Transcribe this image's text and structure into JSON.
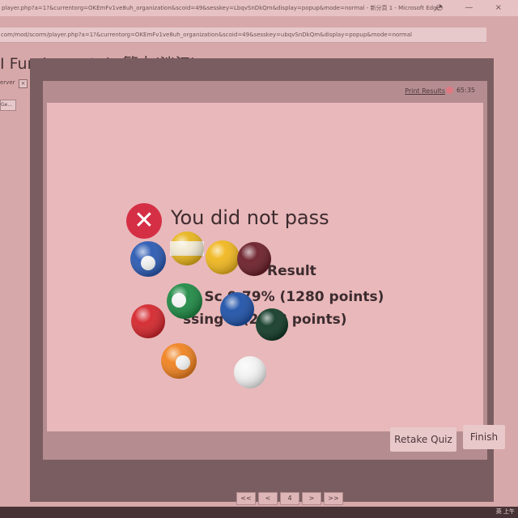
{
  "browser": {
    "window_title": "player.php?a=1?&currentorg=OKEmFv1ve8uh_organization&scoid=49&sesskey=LbqvSnDkQm&display=popup&mode=normal - 新分頁 1 - Microsoft Edge",
    "address": "com/mod/scorm/player.php?a=1?&currentorg=OKEmFv1ve8uh_organization&scoid=49&sesskey=ubqvSnDkQm&display=popup&mode=normal",
    "controls": "◔  —  ×"
  },
  "page": {
    "title": "I Fundamentals 繁中(淡江)",
    "side_text": "erver",
    "side_mini": "×",
    "side_go": "Ge..."
  },
  "quiz": {
    "print_results": "Print Results",
    "timer": "65:35",
    "fail_icon": "✕",
    "fail_heading": "You did not pass",
    "result_label": "Result",
    "score_line": "ur Sc   0.79% (1280 points)",
    "passing_line": "ssing        e   (2268 points)",
    "retake_button": "Retake Quiz",
    "finish_button": "Finish"
  },
  "pager": [
    "<<",
    "<",
    "4",
    ">",
    ">>"
  ],
  "taskbar": {
    "tray": "英  上午"
  },
  "colors": {
    "fail_red": "#d52f45",
    "card_bg": "#e9b8ba",
    "screen_bg": "#d7a8aa"
  }
}
